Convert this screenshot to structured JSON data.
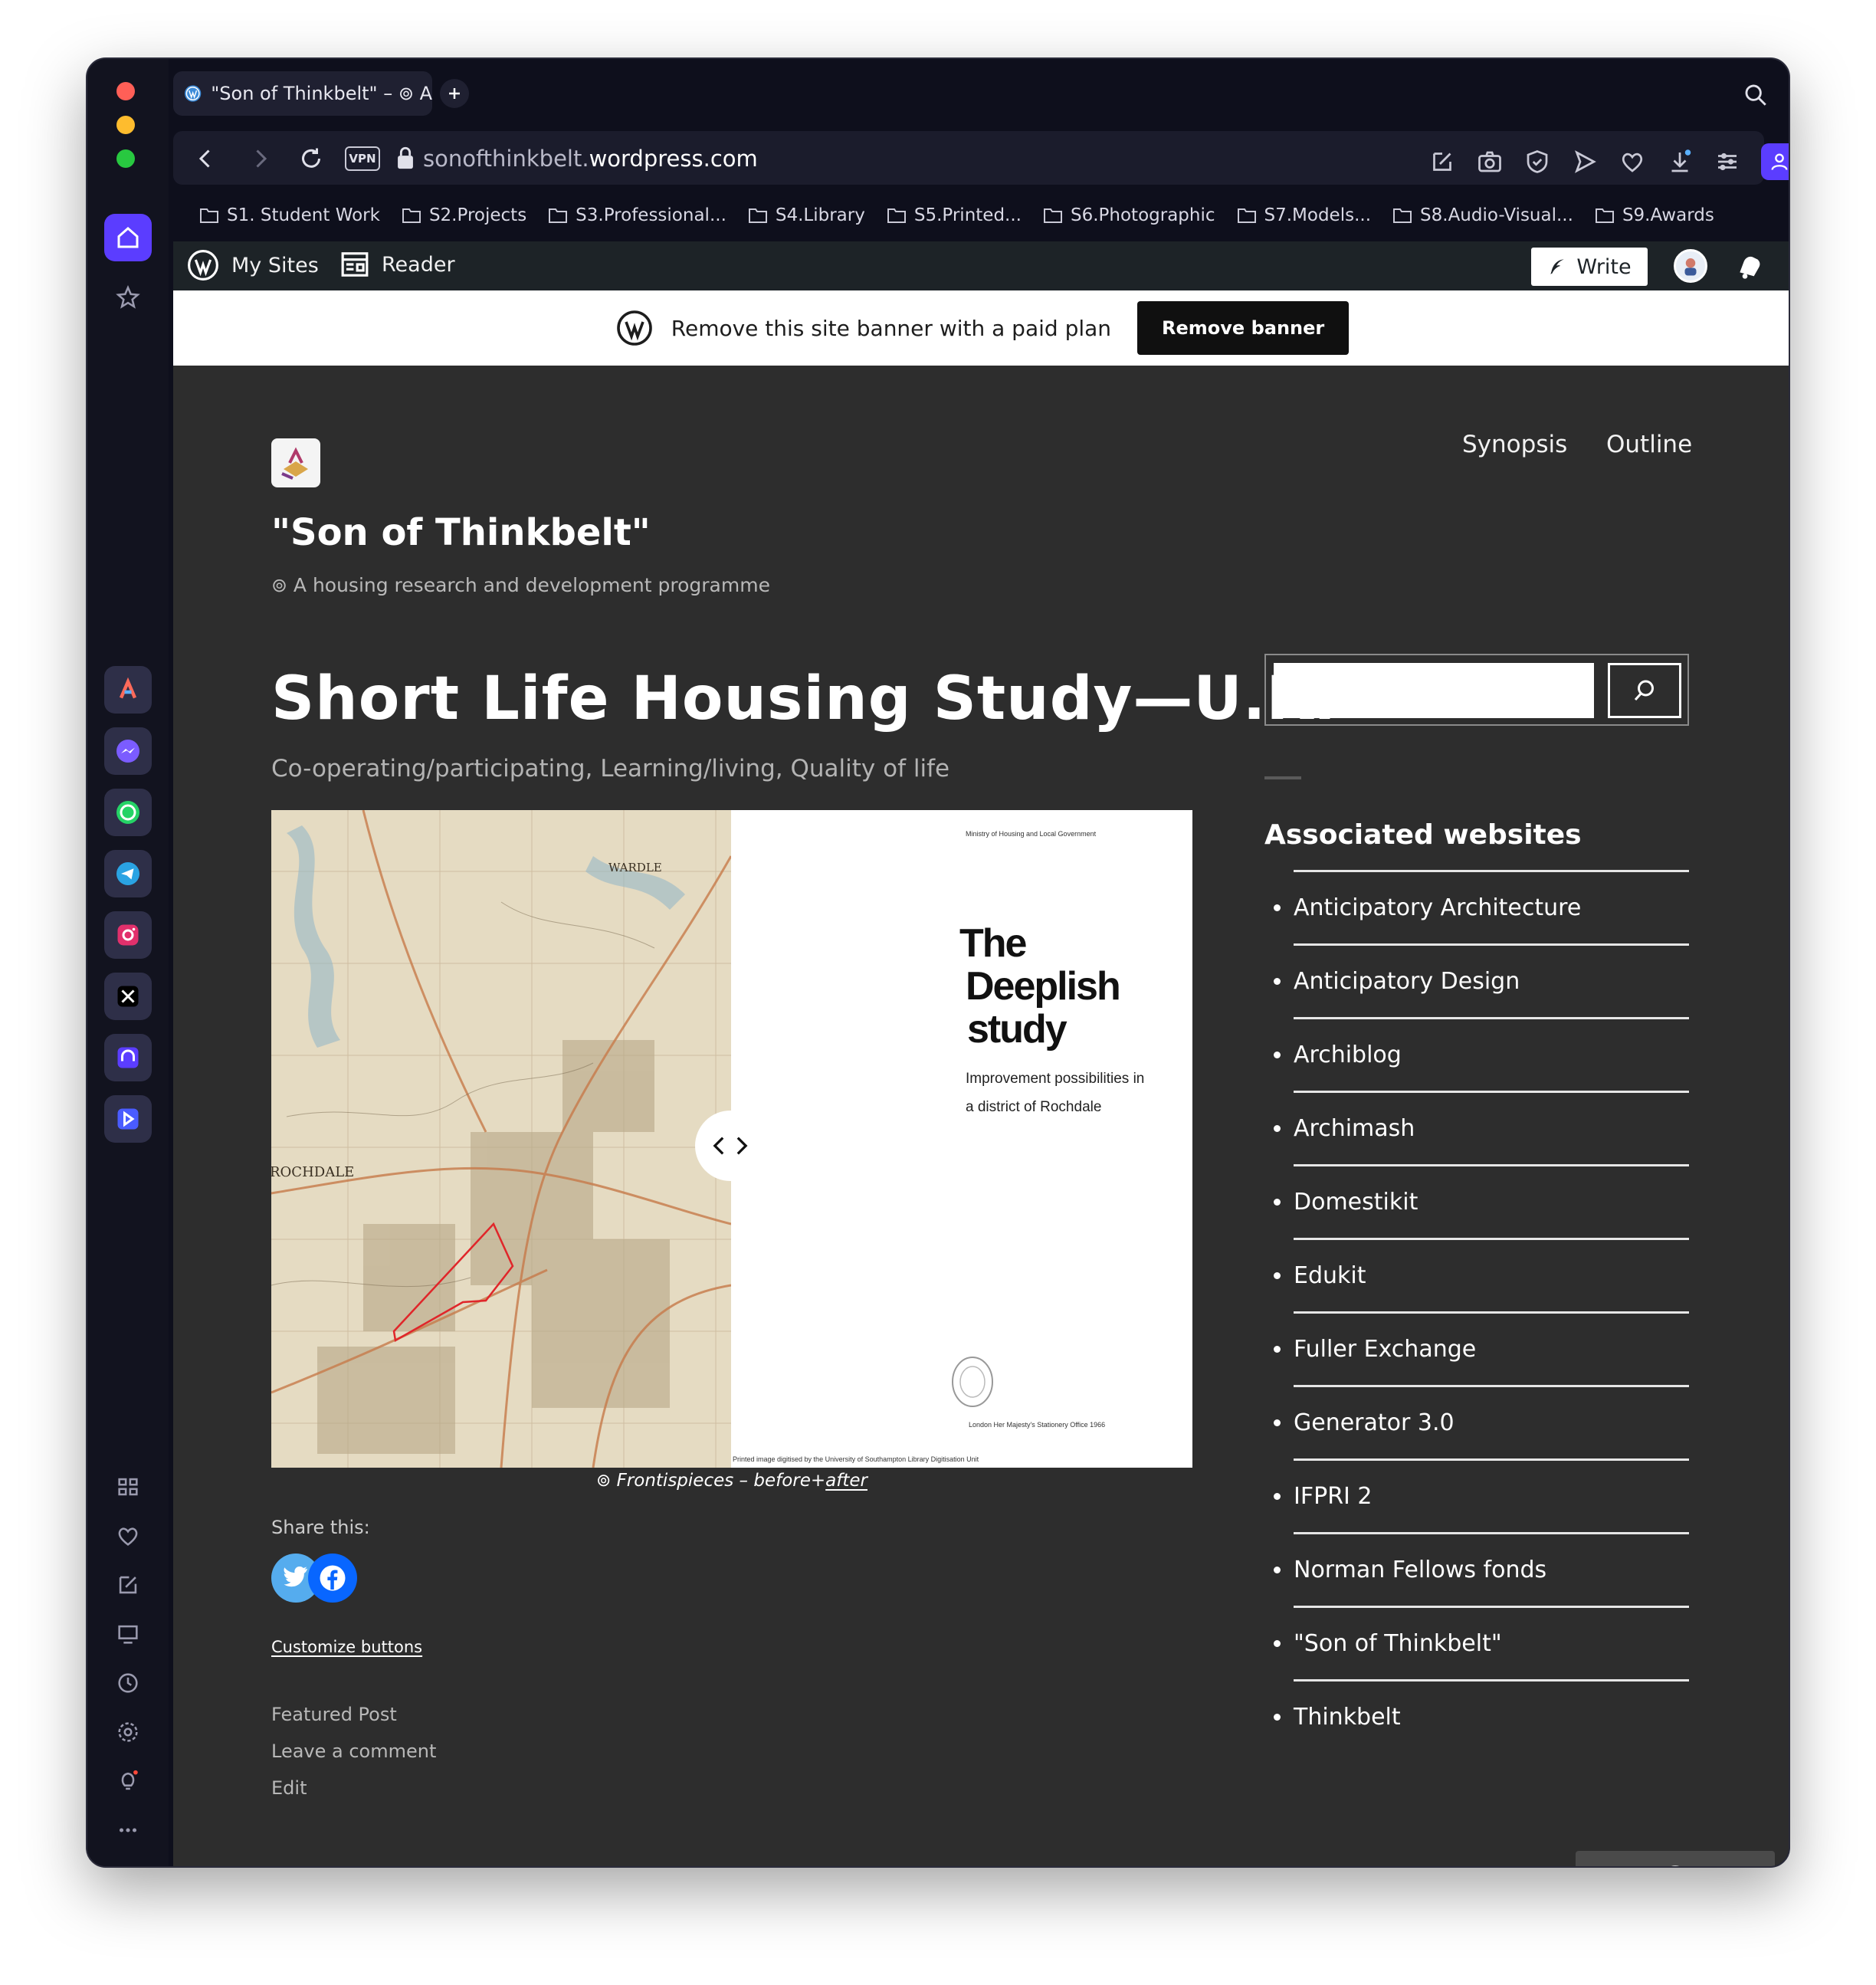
{
  "browser": {
    "tab_title": "\"Son of Thinkbelt\" – ⊚ A",
    "url_host_prefix": "sonofthinkbelt.",
    "url_host_main": "wordpress.com",
    "vpn_label": "VPN",
    "bookmarks": [
      {
        "label": "S1. Student Work"
      },
      {
        "label": "S2.Projects"
      },
      {
        "label": "S3.Professional..."
      },
      {
        "label": "S4.Library"
      },
      {
        "label": "S5.Printed..."
      },
      {
        "label": "S6.Photographic"
      },
      {
        "label": "S7.Models..."
      },
      {
        "label": "S8.Audio-Visual..."
      },
      {
        "label": "S9.Awards"
      }
    ],
    "accent": "#5b3dff"
  },
  "wpbar": {
    "my_sites": "My Sites",
    "reader": "Reader",
    "write": "Write"
  },
  "banner": {
    "text": "Remove this site banner with a paid plan",
    "button": "Remove banner"
  },
  "site": {
    "nav": [
      "Synopsis",
      "Outline"
    ],
    "title": "\"Son of Thinkbelt\"",
    "tagline": "⊚ A housing research and development programme"
  },
  "post": {
    "title": "Short Life Housing Study—U.K.",
    "categories": "Co-operating/participating, Learning/living, Quality of life",
    "gallery": {
      "map_label_top": "WARDLE",
      "map_label_left": "ROCHDALE",
      "doc_ministry": "Ministry of Housing and Local Government",
      "doc_title_1": "The",
      "doc_title_2": "Deeplish",
      "doc_title_3": "study",
      "doc_sub_1": "Improvement possibilities in",
      "doc_sub_2": "a district of Rochdale",
      "doc_publisher": "London Her Majesty's Stationery Office 1966",
      "doc_digitised": "Printed image digitised by the University of Southampton Library Digitisation Unit"
    },
    "caption_prefix": "⊚ Frontispieces – before+",
    "caption_link": "after",
    "share_label": "Share this:",
    "customize": "Customize buttons",
    "meta": [
      "Featured Post",
      "Leave a comment",
      "Edit"
    ]
  },
  "sidebar": {
    "search_placeholder": "",
    "widget_title": "Associated websites",
    "sites": [
      "Anticipatory Architecture",
      "Anticipatory Design",
      "Archiblog",
      "Archimash",
      "Domestikit",
      "Edukit",
      "Fuller Exchange",
      "Generator 3.0",
      "IFPRI 2",
      "Norman Fellows fonds",
      "\"Son of Thinkbelt\"",
      "Thinkbelt"
    ]
  }
}
